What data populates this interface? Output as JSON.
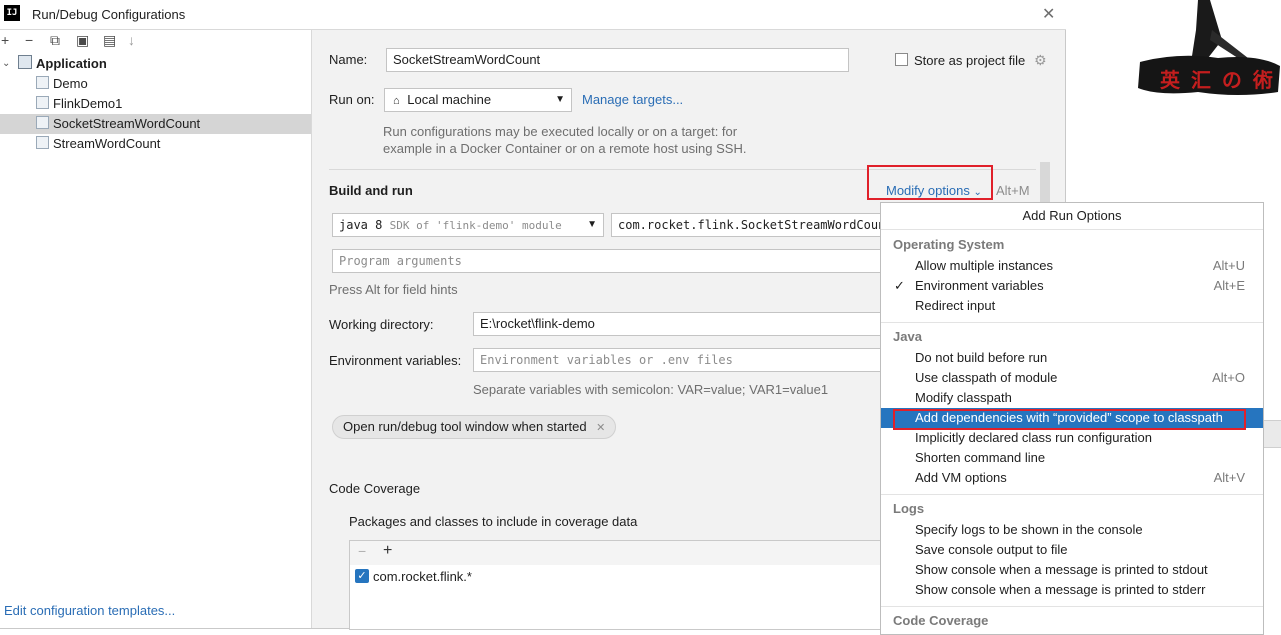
{
  "window": {
    "title": "Run/Debug Configurations",
    "logo": "IJ"
  },
  "toolbar": {
    "icons": [
      "add-icon",
      "remove-icon",
      "copy-icon",
      "save-icon",
      "folder-icon",
      "sort-icon"
    ],
    "add": "+",
    "remove": "−",
    "copy": "⧉",
    "save": "▣",
    "folder": "▤",
    "sort": "↓"
  },
  "tree": {
    "group": "Application",
    "items": [
      "Demo",
      "FlinkDemo1",
      "SocketStreamWordCount",
      "StreamWordCount"
    ],
    "selected": "SocketStreamWordCount"
  },
  "edit_templates": "Edit configuration templates...",
  "form": {
    "name_label": "Name:",
    "name_value": "SocketStreamWordCount",
    "store_label": "Store as project file",
    "run_on_label": "Run on:",
    "run_on_value": "Local machine",
    "manage_targets": "Manage targets...",
    "run_on_hint_1": "Run configurations may be executed locally or on a target: for",
    "run_on_hint_2": "example in a Docker Container or on a remote host using SSH.",
    "build_run": "Build and run",
    "modify_options": "Modify options",
    "modify_shortcut": "Alt+M",
    "jdk_value": "java 8",
    "jdk_hint": "SDK of 'flink-demo' module",
    "main_class": "com.rocket.flink.SocketStreamWordCount",
    "program_args_placeholder": "Program arguments",
    "alt_hint": "Press Alt for field hints",
    "working_dir_label": "Working directory:",
    "working_dir_value": "E:\\rocket\\flink-demo",
    "env_label": "Environment variables:",
    "env_placeholder": "Environment variables or .env files",
    "env_hint": "Separate variables with semicolon: VAR=value; VAR1=value1",
    "open_tool_window": "Open run/debug tool window when started",
    "code_coverage": "Code Coverage",
    "packages_label": "Packages and classes to include in coverage data",
    "coverage_item": "com.rocket.flink.*",
    "coverage_remove": "−",
    "coverage_add": "+"
  },
  "popup": {
    "title": "Add Run Options",
    "groups": [
      {
        "name": "Operating System",
        "items": [
          {
            "label": "Allow multiple instances",
            "shortcut": "Alt+U",
            "checked": false
          },
          {
            "label": "Environment variables",
            "shortcut": "Alt+E",
            "checked": true
          },
          {
            "label": "Redirect input",
            "shortcut": "",
            "checked": false
          }
        ]
      },
      {
        "name": "Java",
        "items": [
          {
            "label": "Do not build before run",
            "shortcut": "",
            "checked": false
          },
          {
            "label": "Use classpath of module",
            "shortcut": "Alt+O",
            "checked": false
          },
          {
            "label": "Modify classpath",
            "shortcut": "",
            "checked": false
          },
          {
            "label": "Add dependencies with “provided” scope to classpath",
            "shortcut": "",
            "checked": false,
            "selected": true
          },
          {
            "label": "Implicitly declared class run configuration",
            "shortcut": "",
            "checked": false
          },
          {
            "label": "Shorten command line",
            "shortcut": "",
            "checked": false
          },
          {
            "label": "Add VM options",
            "shortcut": "Alt+V",
            "checked": false
          }
        ]
      },
      {
        "name": "Logs",
        "items": [
          {
            "label": "Specify logs to be shown in the console",
            "shortcut": "",
            "checked": false
          },
          {
            "label": "Save console output to file",
            "shortcut": "",
            "checked": false
          },
          {
            "label": "Show console when a message is printed to stdout",
            "shortcut": "",
            "checked": false
          },
          {
            "label": "Show console when a message is printed to stderr",
            "shortcut": "",
            "checked": false
          }
        ]
      },
      {
        "name": "Code Coverage",
        "items": []
      }
    ]
  },
  "watermark": {
    "text": "英 汇 の 術"
  },
  "colors": {
    "accent": "#2675bf",
    "link": "#2a6db5",
    "highlight": "#e0202a"
  }
}
